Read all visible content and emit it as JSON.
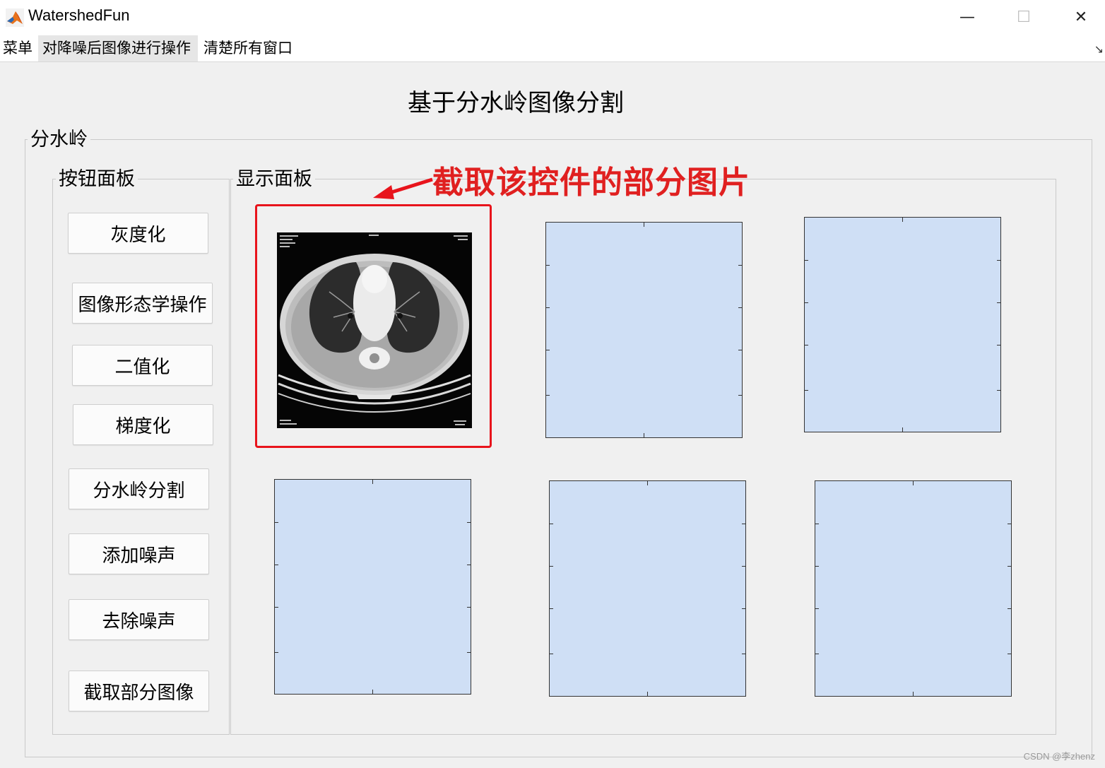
{
  "window": {
    "title": "WatershedFun",
    "minimize": "—",
    "maximize": "☐",
    "close": "✕"
  },
  "menu": {
    "items": [
      "菜单",
      "对降噪后图像进行操作",
      "清楚所有窗口"
    ],
    "corner": "↘"
  },
  "main_title": "基于分水岭图像分割",
  "outer_group": {
    "label": "分水岭"
  },
  "button_panel": {
    "label": "按钮面板",
    "buttons": [
      "灰度化",
      "图像形态学操作",
      "二值化",
      "梯度化",
      "分水岭分割",
      "添加噪声",
      "去除噪声",
      "截取部分图像"
    ]
  },
  "display_panel": {
    "label": "显示面板"
  },
  "annotation": {
    "text": "截取该控件的部分图片",
    "color": "#e8141c"
  },
  "colors": {
    "axes_bg": "#cfdff5",
    "window_bg": "#f0f0f0"
  },
  "watermark": "CSDN @李zhenz"
}
